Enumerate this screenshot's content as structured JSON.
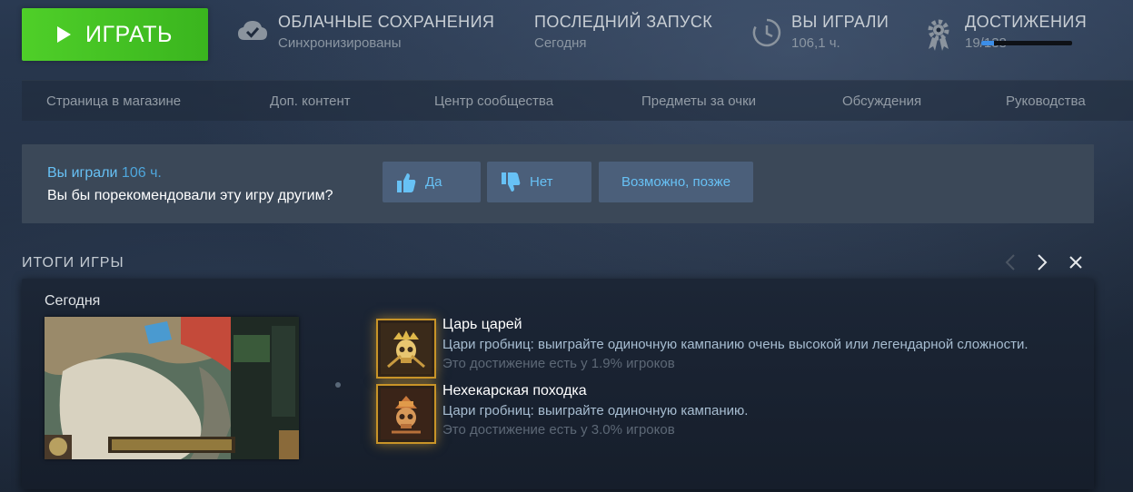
{
  "header": {
    "play_label": "ИГРАТЬ",
    "cloud": {
      "title": "ОБЛАЧНЫЕ СОХРАНЕНИЯ",
      "status": "Синхронизированы",
      "icon": "cloud-check-icon"
    },
    "last_launch": {
      "title": "ПОСЛЕДНИЙ ЗАПУСК",
      "value": "Сегодня"
    },
    "played": {
      "title": "ВЫ ИГРАЛИ",
      "value": "106,1 ч.",
      "icon": "clock-icon"
    },
    "achievements": {
      "title": "ДОСТИЖЕНИЯ",
      "value": "19/138",
      "progress": 0.138,
      "icon": "achievement-gear-icon"
    }
  },
  "nav": {
    "items": [
      {
        "label": "Страница в магазине"
      },
      {
        "label": "Доп. контент"
      },
      {
        "label": "Центр сообщества"
      },
      {
        "label": "Предметы за очки"
      },
      {
        "label": "Обсуждения"
      },
      {
        "label": "Руководства"
      }
    ]
  },
  "recommend": {
    "played_prefix": "Вы играли",
    "played_value": "106 ч.",
    "question": "Вы бы порекомендовали эту игру другим?",
    "yes_label": "Да",
    "no_label": "Нет",
    "later_label": "Возможно, позже"
  },
  "summary": {
    "title": "ИТОГИ ИГРЫ",
    "date": "Сегодня",
    "achievements": [
      {
        "name": "Царь царей",
        "description": "Цари гробниц: выиграйте одиночную кампанию очень высокой или легендарной сложности.",
        "percent": "Это достижение есть у 1.9% игроков"
      },
      {
        "name": "Нехекарская походка",
        "description": "Цари гробниц: выиграйте одиночную кампанию.",
        "percent": "Это достижение есть у 3.0% игроков"
      }
    ]
  },
  "colors": {
    "play_green": "#4fcf29",
    "accent_blue": "#67c1f5",
    "achievement_gold": "#c89428"
  }
}
